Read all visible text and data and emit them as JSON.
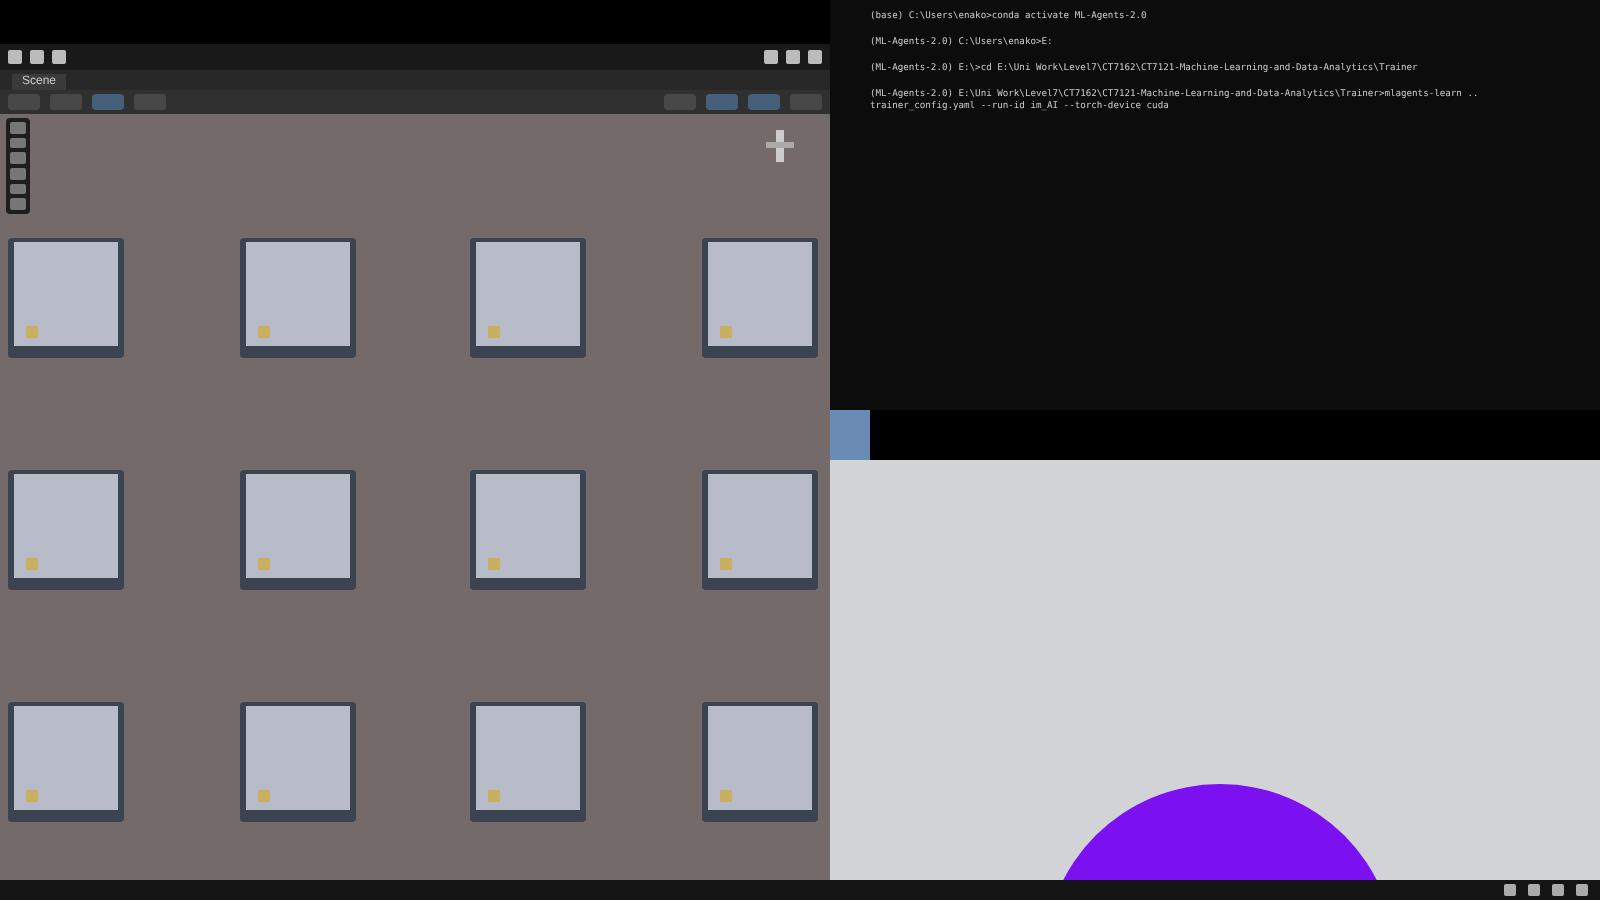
{
  "scene_tab": {
    "label": "Scene"
  },
  "terminal": {
    "lines": [
      "(base) C:\\Users\\enako>conda activate ML-Agents-2.0",
      "(ML-Agents-2.0) C:\\Users\\enako>E:",
      "(ML-Agents-2.0) E:\\>cd E:\\Uni Work\\Level7\\CT7162\\CT7121-Machine-Learning-and-Data-Analytics\\Trainer",
      "(ML-Agents-2.0) E:\\Uni Work\\Level7\\CT7162\\CT7121-Machine-Learning-and-Data-Analytics\\Trainer>mlagents-learn ..\ntrainer_config.yaml --run-id im_AI --torch-device cuda"
    ]
  }
}
